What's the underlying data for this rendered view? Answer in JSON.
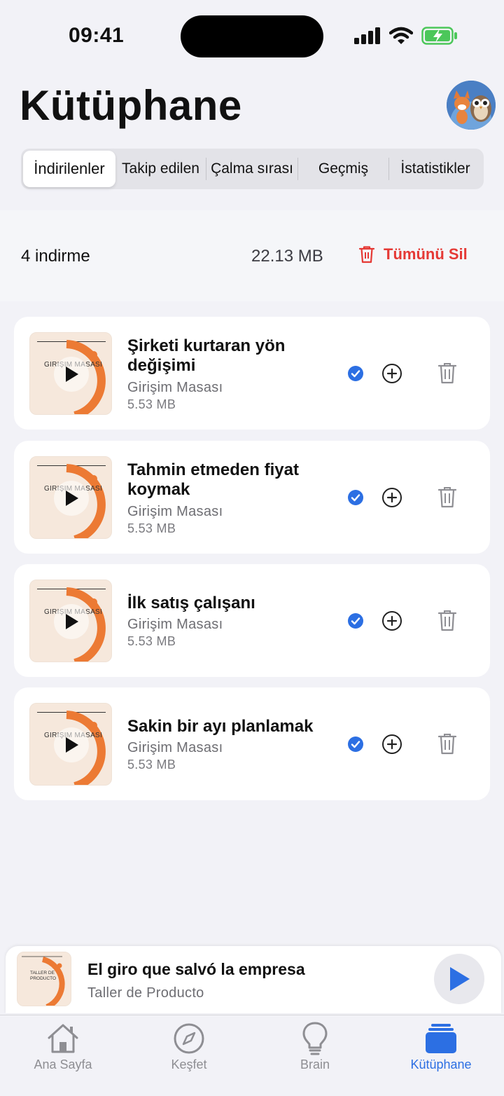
{
  "status_bar": {
    "time": "09:41"
  },
  "header": {
    "title": "Kütüphane"
  },
  "tabs": [
    {
      "label": "İndirilenler",
      "active": true
    },
    {
      "label": "Takip edilen",
      "active": false
    },
    {
      "label": "Çalma sırası",
      "active": false
    },
    {
      "label": "Geçmiş",
      "active": false
    },
    {
      "label": "İstatistikler",
      "active": false
    }
  ],
  "summary": {
    "count": "4 indirme",
    "total_size": "22.13 MB",
    "delete_all_label": "Tümünü Sil"
  },
  "downloads": [
    {
      "title": "Şirketi kurtaran yön değişimi",
      "podcast": "Girişim Masası",
      "size": "5.53 MB",
      "thumb_label": "GIRIŞIM MASASI"
    },
    {
      "title": "Tahmin etmeden fiyat koymak",
      "podcast": "Girişim Masası",
      "size": "5.53 MB",
      "thumb_label": "GIRIŞIM MASASI"
    },
    {
      "title": "İlk satış çalışanı",
      "podcast": "Girişim Masası",
      "size": "5.53 MB",
      "thumb_label": "GIRIŞIM MASASI"
    },
    {
      "title": "Sakin bir ayı planlamak",
      "podcast": "Girişim Masası",
      "size": "5.53 MB",
      "thumb_label": "GIRIŞIM MASASI"
    }
  ],
  "mini_player": {
    "title": "El giro que salvó la empresa",
    "podcast": "Taller de Producto",
    "thumb_label": "TALLER DE PRODUCTO"
  },
  "tabbar": [
    {
      "label": "Ana Sayfa",
      "icon": "house-icon",
      "active": false
    },
    {
      "label": "Keşfet",
      "icon": "compass-icon",
      "active": false
    },
    {
      "label": "Brain",
      "icon": "lightbulb-icon",
      "active": false
    },
    {
      "label": "Kütüphane",
      "icon": "library-icon",
      "active": true
    }
  ],
  "colors": {
    "accent": "#2c6fe3",
    "danger": "#e53935",
    "thumb_orange": "#ec7a34",
    "background": "#f2f2f7"
  }
}
